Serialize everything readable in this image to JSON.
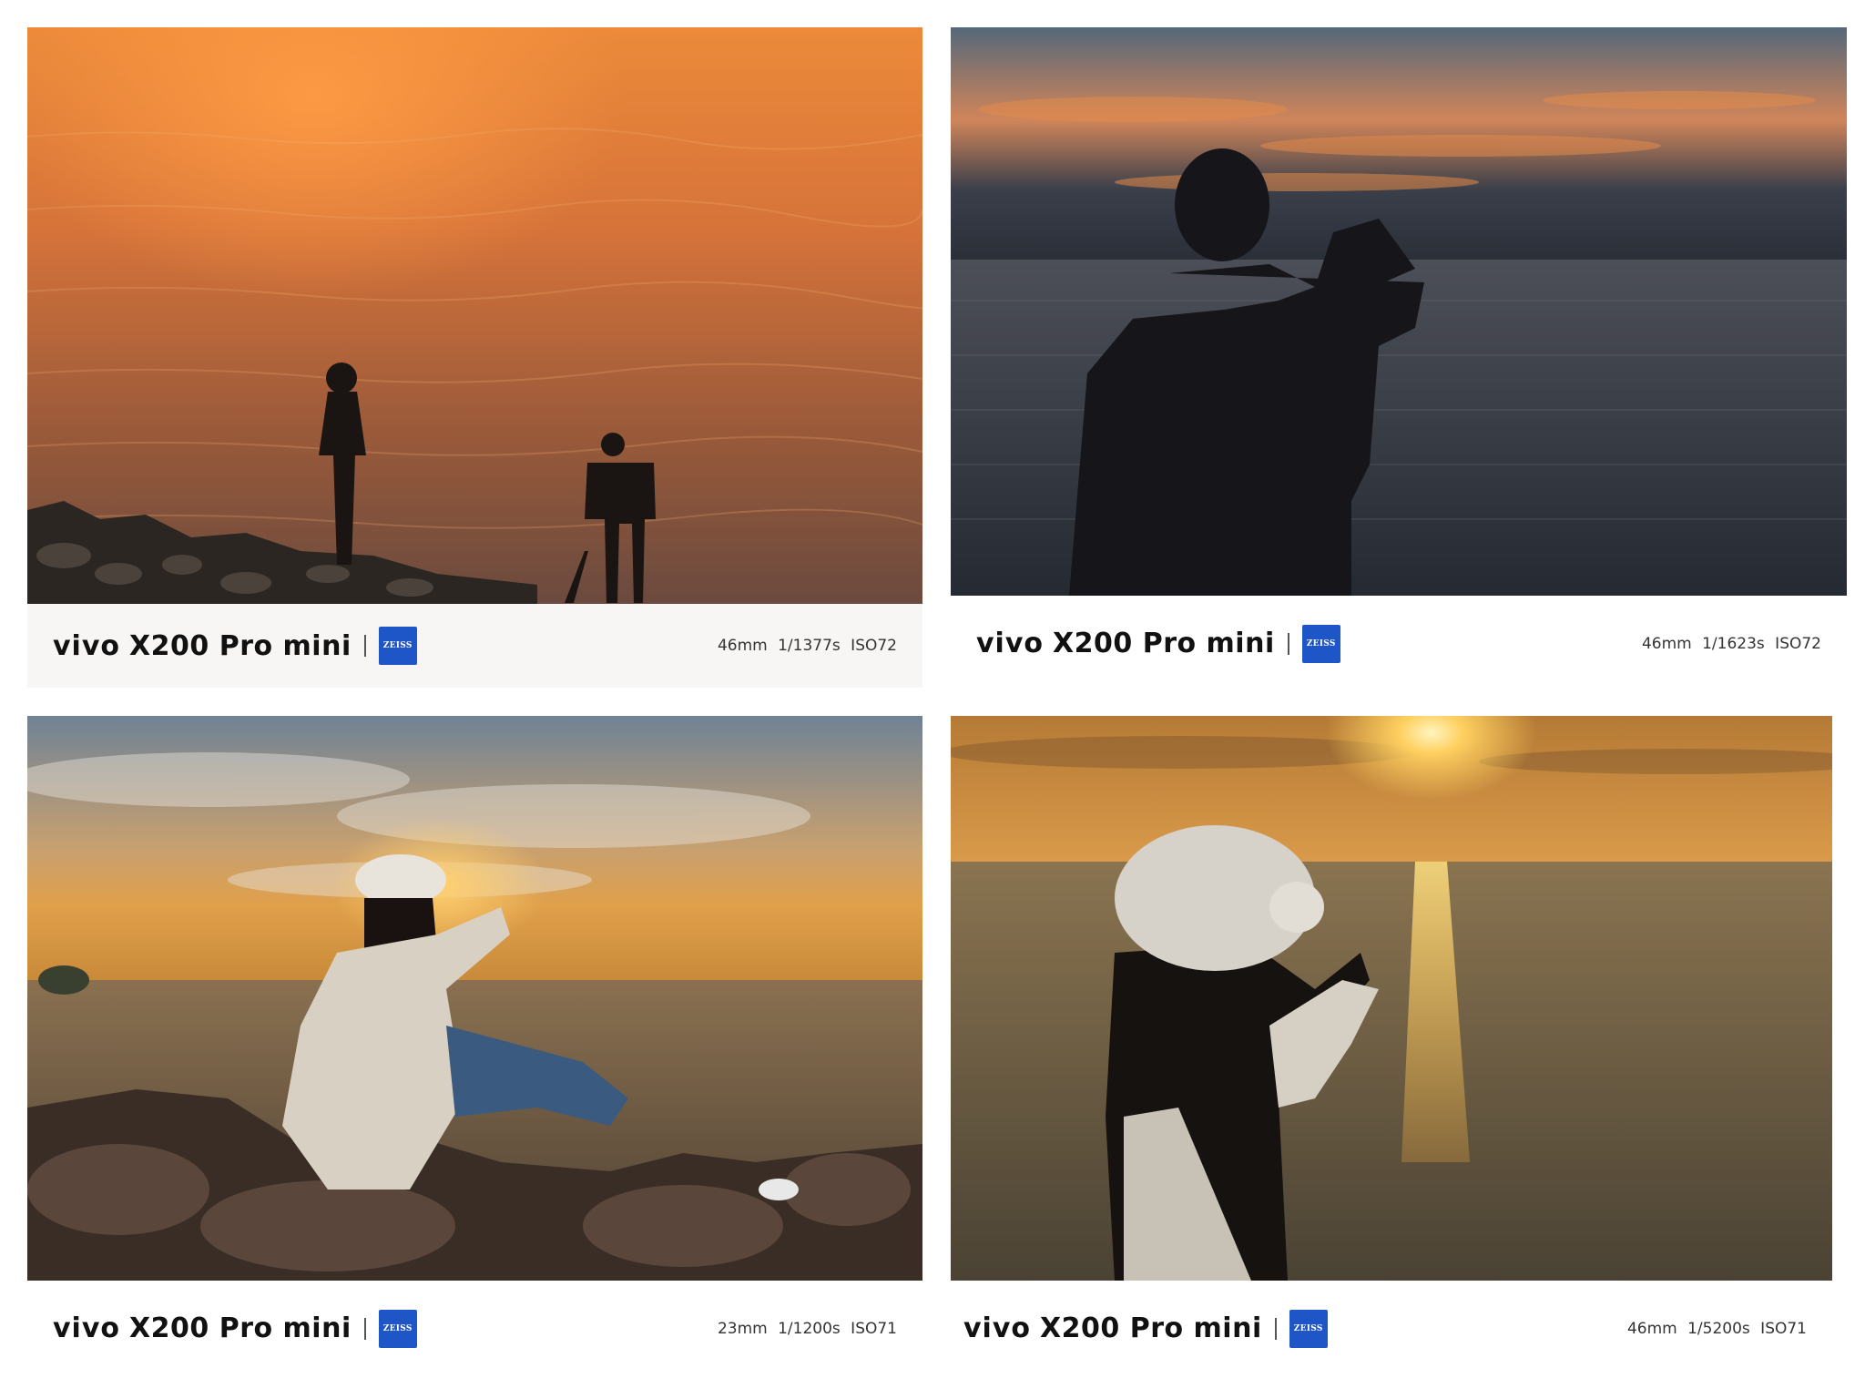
{
  "photos": [
    {
      "brand": "vivo",
      "model": "X200 Pro mini",
      "lens_badge": "ZEISS",
      "exif": "46mm  1/1377s  ISO72",
      "colors": {
        "sky_top": "#e98a3b",
        "water": "#b05a2a",
        "caption_bg": "#f7f6f4"
      }
    },
    {
      "brand": "vivo",
      "model": "X200 Pro mini",
      "lens_badge": "ZEISS",
      "exif": "46mm  1/1623s  ISO72",
      "colors": {
        "sky_top": "#4a5a6a",
        "glow": "#e3884a",
        "water": "#2b3138"
      }
    },
    {
      "brand": "vivo",
      "model": "X200 Pro mini",
      "lens_badge": "ZEISS",
      "exif": "23mm  1/1200s  ISO71",
      "colors": {
        "sky_top": "#6e8294",
        "glow": "#d8a050",
        "water": "#6a5840"
      }
    },
    {
      "brand": "vivo",
      "model": "X200 Pro mini",
      "lens_badge": "ZEISS",
      "exif": "46mm  1/5200s  ISO71",
      "colors": {
        "sky_top": "#b07a33",
        "glow": "#ffd76a",
        "water": "#6b5a38"
      }
    }
  ]
}
